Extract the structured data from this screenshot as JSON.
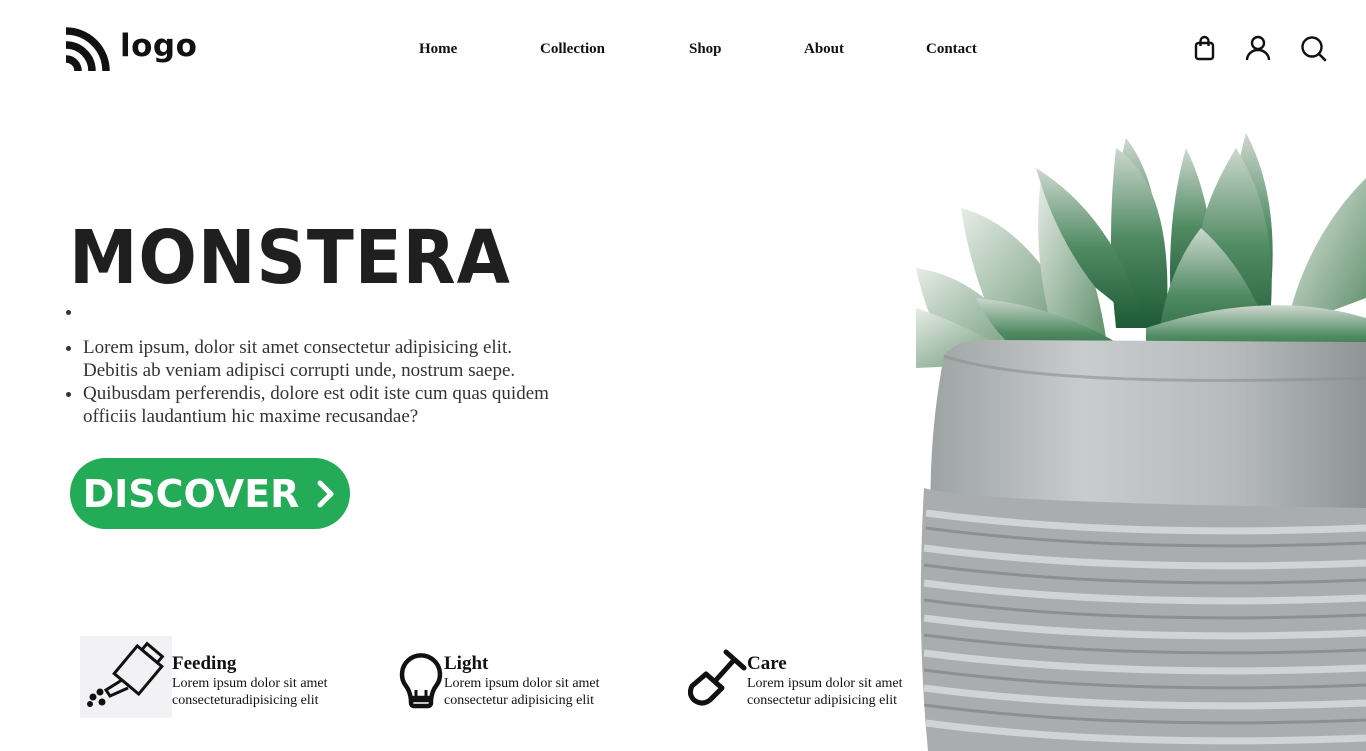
{
  "header": {
    "logo_text": "logo",
    "nav": [
      "Home",
      "Collection",
      "Shop",
      "About",
      "Contact"
    ],
    "icons": [
      "shopping-bag-icon",
      "user-icon",
      "search-icon"
    ]
  },
  "hero": {
    "title": "MONSTERA",
    "paragraphs": [
      "Lorem ipsum, dolor sit amet consectetur adipisicing elit. Debitis ab veniam adipisci corrupti unde, nostrum saepe.",
      "Quibusdam perferendis, dolore est odit iste cum quas quidem officiis laudantium hic maxime recusandae?"
    ],
    "cta_label": "DISCOVER",
    "cta_color": "#23ab58"
  },
  "features": [
    {
      "icon": "watering-can-icon",
      "title": "Feeding",
      "desc": "Lorem ipsum dolor sit amet consecteturadipisicing elit"
    },
    {
      "icon": "lightbulb-icon",
      "title": "Light",
      "desc": "Lorem ipsum dolor sit amet consectetur adipisicing elit"
    },
    {
      "icon": "shovel-icon",
      "title": "Care",
      "desc": "Lorem ipsum dolor sit amet consectetur adipisicing elit"
    }
  ]
}
